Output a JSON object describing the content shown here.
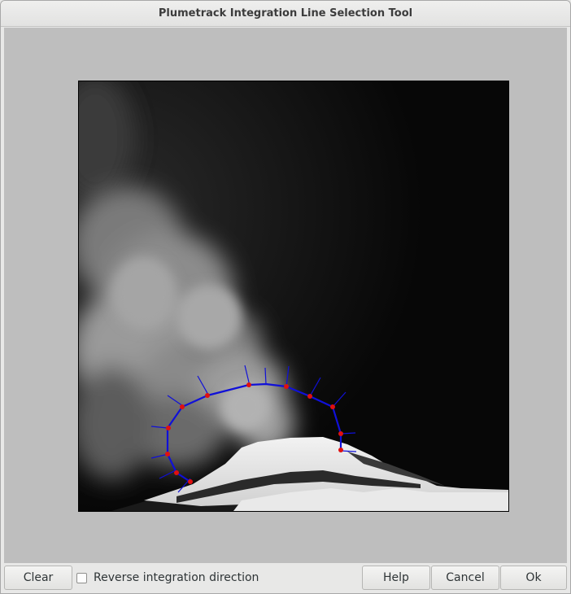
{
  "window": {
    "title": "Plumetrack Integration Line Selection Tool"
  },
  "canvas": {
    "background_color": "#bebebe",
    "image_description_icon": "volcano-plume-photo",
    "line_color": "#1010d8",
    "point_color": "#e01010",
    "point_count": 13
  },
  "controls": {
    "clear_label": "Clear",
    "reverse_label": "Reverse integration direction",
    "reverse_checked": false,
    "help_label": "Help",
    "cancel_label": "Cancel",
    "ok_label": "Ok"
  }
}
